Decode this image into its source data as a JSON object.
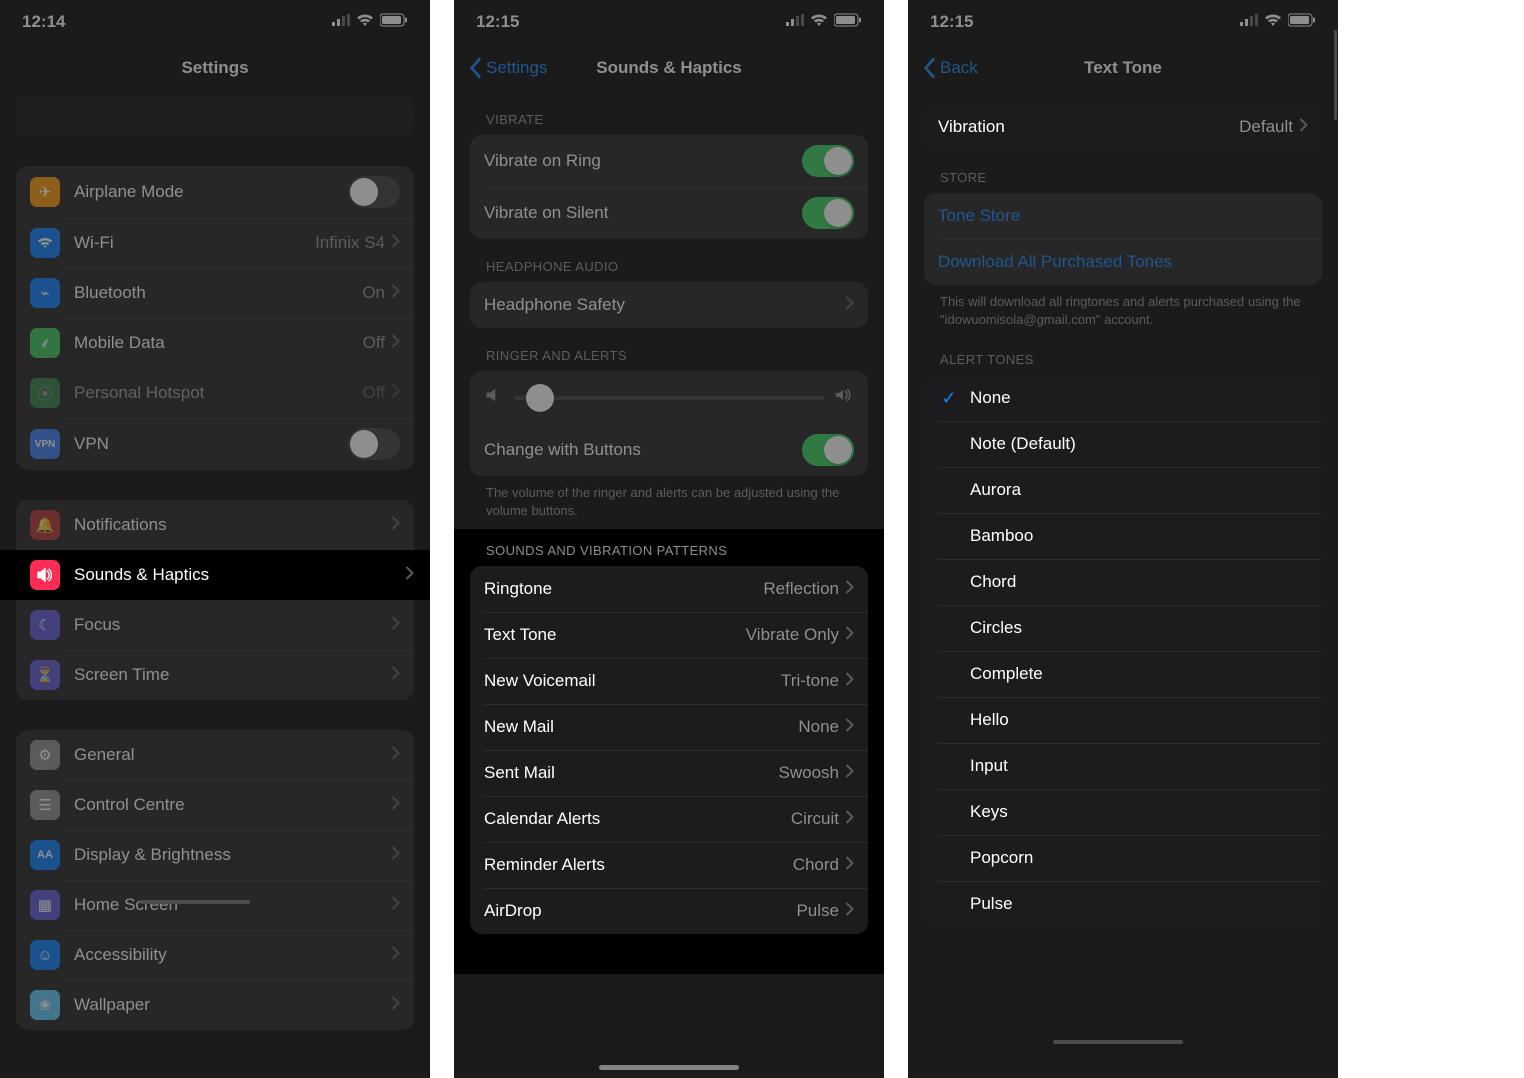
{
  "phone1": {
    "time": "12:14",
    "title": "Settings",
    "rows": {
      "airplane": "Airplane Mode",
      "wifi": {
        "label": "Wi-Fi",
        "value": "Infinix S4"
      },
      "bluetooth": {
        "label": "Bluetooth",
        "value": "On"
      },
      "mobile": {
        "label": "Mobile Data",
        "value": "Off"
      },
      "hotspot": {
        "label": "Personal Hotspot",
        "value": "Off"
      },
      "vpn": "VPN",
      "notifications": "Notifications",
      "sounds": "Sounds & Haptics",
      "focus": "Focus",
      "screentime": "Screen Time",
      "general": "General",
      "control": "Control Centre",
      "display": "Display & Brightness",
      "home": "Home Screen",
      "accessibility": "Accessibility",
      "wallpaper": "Wallpaper"
    }
  },
  "phone2": {
    "time": "12:15",
    "back": "Settings",
    "title": "Sounds & Haptics",
    "headers": {
      "vibrate": "Vibrate",
      "headphone": "Headphone Audio",
      "ringer": "Ringer and Alerts",
      "sounds": "Sounds and Vibration Patterns"
    },
    "vibrateRing": "Vibrate on Ring",
    "vibrateSilent": "Vibrate on Silent",
    "headphoneSafety": "Headphone Safety",
    "changeButtons": "Change with Buttons",
    "ringerFooter": "The volume of the ringer and alerts can be adjusted using the volume buttons.",
    "sounds": [
      {
        "label": "Ringtone",
        "value": "Reflection"
      },
      {
        "label": "Text Tone",
        "value": "Vibrate Only"
      },
      {
        "label": "New Voicemail",
        "value": "Tri-tone"
      },
      {
        "label": "New Mail",
        "value": "None"
      },
      {
        "label": "Sent Mail",
        "value": "Swoosh"
      },
      {
        "label": "Calendar Alerts",
        "value": "Circuit"
      },
      {
        "label": "Reminder Alerts",
        "value": "Chord"
      },
      {
        "label": "AirDrop",
        "value": "Pulse"
      }
    ]
  },
  "phone3": {
    "time": "12:15",
    "back": "Back",
    "title": "Text Tone",
    "vibration": {
      "label": "Vibration",
      "value": "Default"
    },
    "storeHeader": "Store",
    "toneStore": "Tone Store",
    "download": "Download All Purchased Tones",
    "storeFooter": "This will download all ringtones and alerts purchased using the \"idowuomisola@gmail.com\" account.",
    "alertHeader": "Alert Tones",
    "tones": [
      "None",
      "Note (Default)",
      "Aurora",
      "Bamboo",
      "Chord",
      "Circles",
      "Complete",
      "Hello",
      "Input",
      "Keys",
      "Popcorn",
      "Pulse"
    ],
    "selectedTone": "None"
  }
}
